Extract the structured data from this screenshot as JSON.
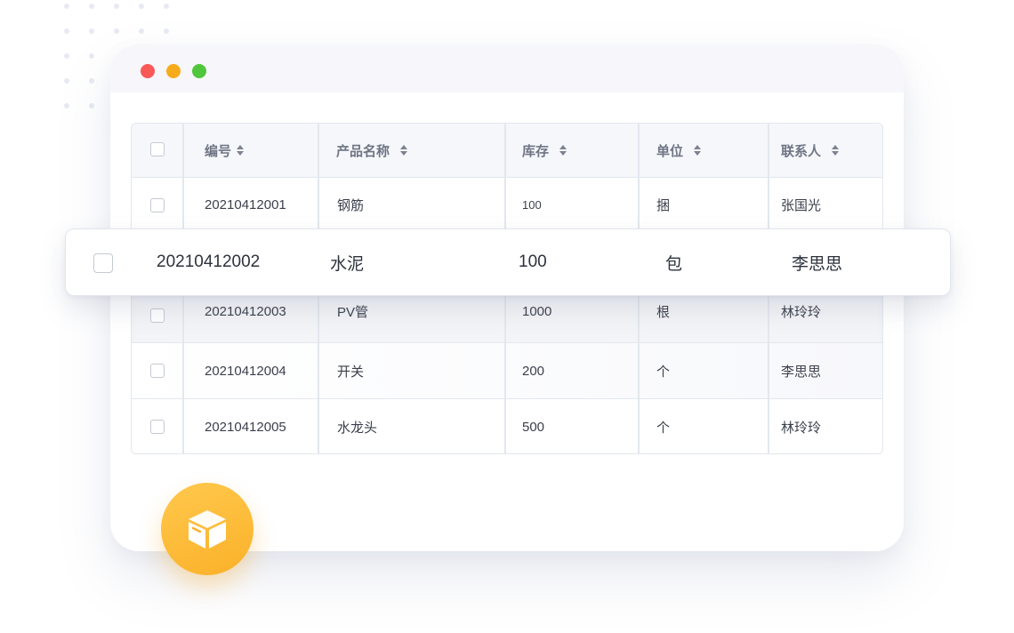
{
  "window": {
    "controls": [
      "close",
      "minimize",
      "maximize"
    ]
  },
  "table": {
    "columns": [
      "编号",
      "产品名称",
      "库存",
      "单位",
      "联系人"
    ],
    "rows": [
      {
        "id": "20210412001",
        "name": "钢筋",
        "stock": "100",
        "unit": "捆",
        "contact": "张国光"
      },
      {
        "id": "20210412003",
        "name": "PV管",
        "stock": "1000",
        "unit": "根",
        "contact": "林玲玲"
      },
      {
        "id": "20210412004",
        "name": "开关",
        "stock": "200",
        "unit": "个",
        "contact": "李思思"
      },
      {
        "id": "20210412005",
        "name": "水龙头",
        "stock": "500",
        "unit": "个",
        "contact": "林玲玲"
      }
    ]
  },
  "highlighted_row": {
    "id": "20210412002",
    "name": "水泥",
    "stock": "100",
    "unit": "包",
    "contact": "李思思"
  },
  "badge": {
    "icon": "box-icon"
  },
  "colors": {
    "close": "#f95a57",
    "minimize": "#f7ab1b",
    "maximize": "#50c63c",
    "badge": "#fbb129",
    "border": "#e3e7ee",
    "header_bg": "#f5f7fa"
  }
}
